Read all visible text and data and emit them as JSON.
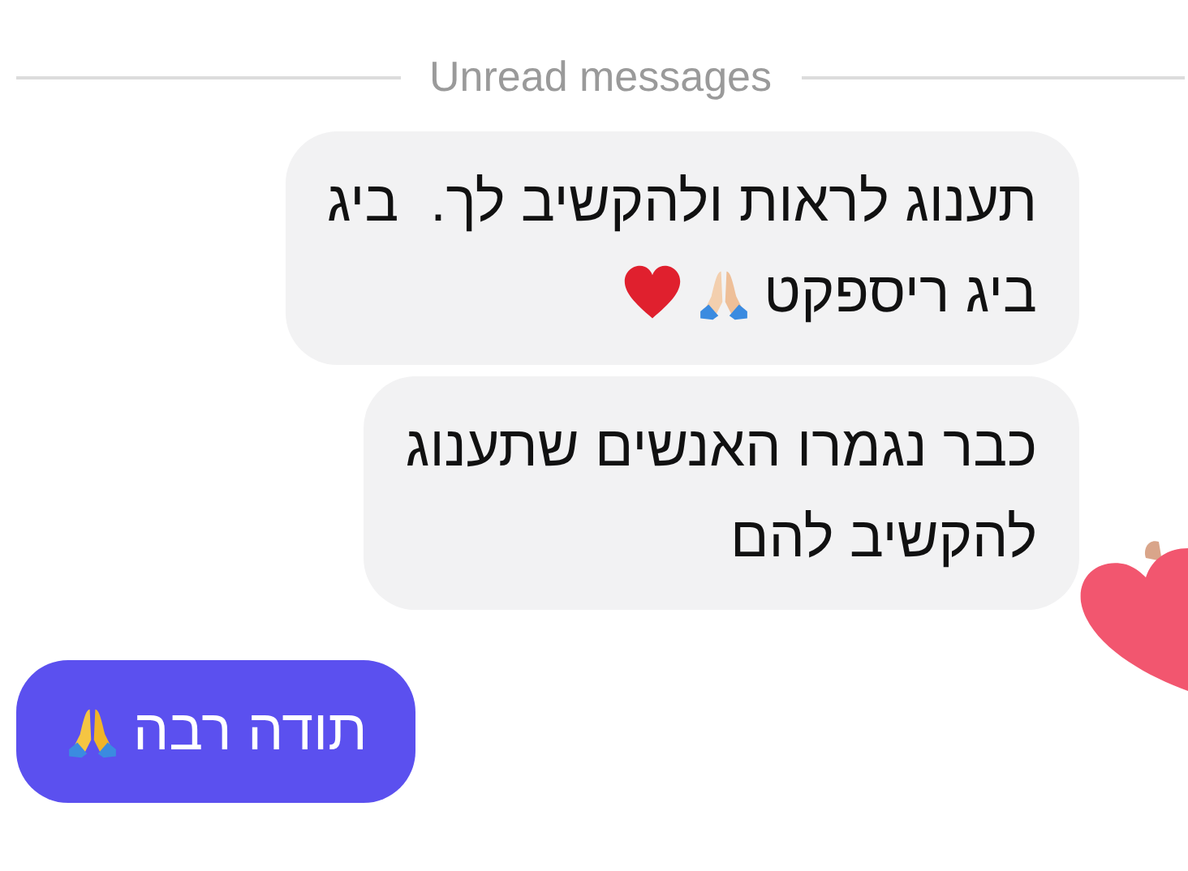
{
  "divider": {
    "label": "Unread messages"
  },
  "messages": [
    {
      "kind": "received",
      "lines": [
        "תענוג לראות ולהקשיב לך.  ביג",
        "ביג ריספקט"
      ],
      "emoji": [
        {
          "kind": "pray"
        },
        {
          "kind": "heart"
        }
      ]
    },
    {
      "kind": "received",
      "lines": [
        "כבר נגמרו האנשים שתענוג",
        "להקשיב להם"
      ]
    },
    {
      "kind": "sent",
      "lines": [
        "תודה רבה"
      ],
      "emoji": [
        {
          "kind": "pray"
        }
      ]
    }
  ],
  "reaction": {
    "kind": "heart"
  }
}
